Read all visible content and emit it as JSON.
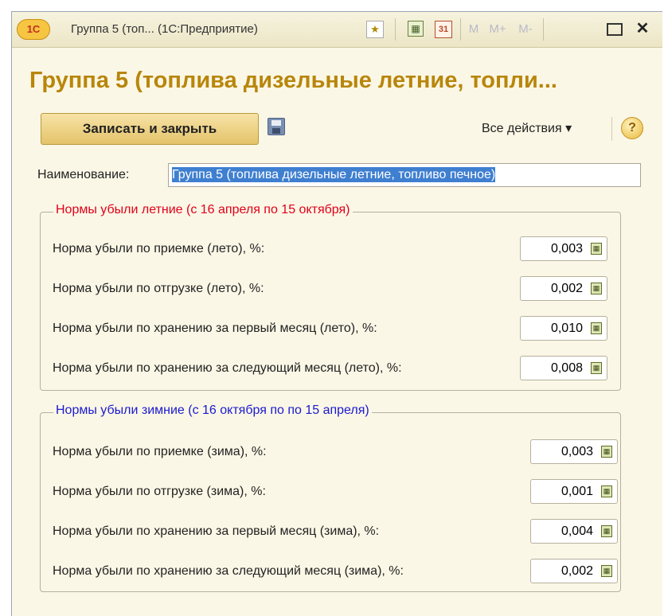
{
  "window": {
    "logo": "1С",
    "title": "Группа 5 (топ...  (1С:Предприятие)",
    "toolbar_icons": [
      "favorite-icon",
      "calculator-icon",
      "calendar-icon"
    ],
    "calendar_day": "31",
    "mem_buttons": [
      "M",
      "M+",
      "M-"
    ]
  },
  "form": {
    "title": "Группа 5 (топлива дизельные летние, топли...",
    "save_close_label": "Записать и закрыть",
    "all_actions_label": "Все действия ▾",
    "help_label": "?",
    "name_label": "Наименование:",
    "name_value": "Группа 5 (топлива дизельные летние, топливо печное)"
  },
  "summer": {
    "legend": "Нормы убыли летние (с 16 апреля по 15 октября)",
    "rows": [
      {
        "label": "Норма убыли по приемке (лето), %:",
        "value": "0,003"
      },
      {
        "label": "Норма убыли по отгрузке (лето), %:",
        "value": "0,002"
      },
      {
        "label": "Норма убыли по хранению за первый месяц (лето), %:",
        "value": "0,010"
      },
      {
        "label": "Норма убыли по хранению за следующий месяц (лето), %:",
        "value": "0,008"
      }
    ]
  },
  "winter": {
    "legend": "Нормы убыли зимние (с 16 октября по по 15 апреля)",
    "rows": [
      {
        "label": "Норма убыли по приемке (зима), %:",
        "value": "0,003"
      },
      {
        "label": "Норма убыли по отгрузке (зима), %:",
        "value": "0,001"
      },
      {
        "label": "Норма убыли по хранению за первый месяц (зима), %:",
        "value": "0,004"
      },
      {
        "label": "Норма убыли по хранению за следующий месяц (зима), %:",
        "value": "0,002"
      }
    ]
  },
  "colors": {
    "title": "#b8860b",
    "summer_legend": "#e0001a",
    "winter_legend": "#1a1ad0",
    "background": "#fbf7e6"
  }
}
